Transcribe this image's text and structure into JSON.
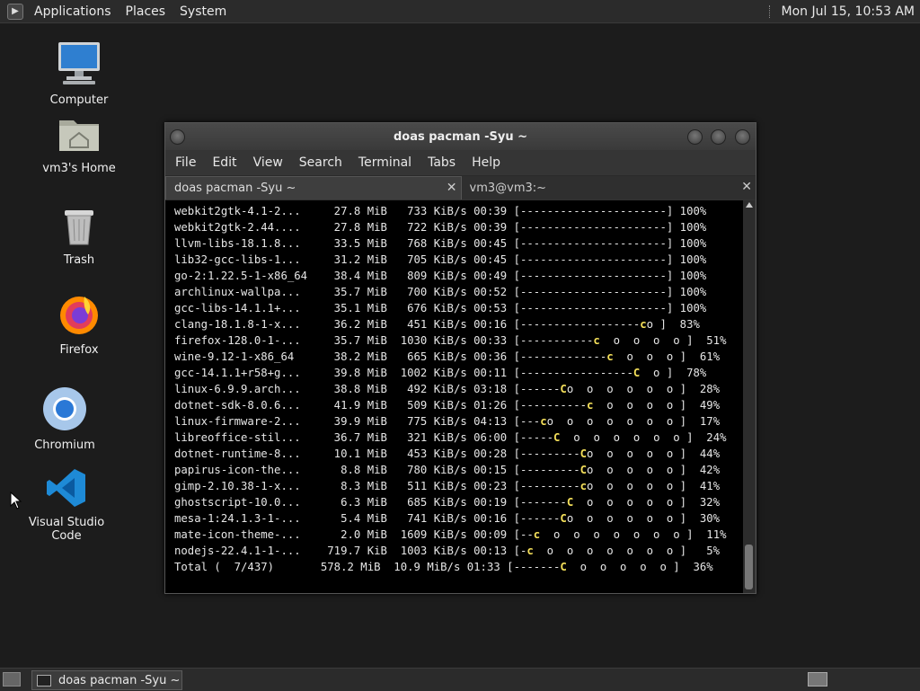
{
  "top_panel": {
    "menus": [
      "Applications",
      "Places",
      "System"
    ],
    "clock": "Mon Jul 15, 10:53 AM"
  },
  "desktop_icons": [
    {
      "label": "Computer",
      "icon": "computer-icon"
    },
    {
      "label": "vm3's Home",
      "icon": "home-folder-icon"
    },
    {
      "label": "Trash",
      "icon": "trash-icon"
    },
    {
      "label": "Firefox",
      "icon": "firefox-icon"
    },
    {
      "label": "Chromium",
      "icon": "chromium-icon"
    },
    {
      "label": "Visual Studio Code",
      "icon": "vscode-icon"
    }
  ],
  "terminal": {
    "title": "doas pacman -Syu ~",
    "menu": [
      "File",
      "Edit",
      "View",
      "Search",
      "Terminal",
      "Tabs",
      "Help"
    ],
    "tabs": [
      {
        "label": "doas pacman -Syu ~",
        "active": true
      },
      {
        "label": "vm3@vm3:~",
        "active": false
      }
    ],
    "lines": [
      [
        "webkit2gtk-4.1-2...     27.8 MiB   733 KiB/s 00:39 [",
        "----------------------] 100%",
        "",
        ""
      ],
      [
        "webkit2gtk-2.44....     27.8 MiB   722 KiB/s 00:39 [",
        "----------------------] 100%",
        "",
        ""
      ],
      [
        "llvm-libs-18.1.8...     33.5 MiB   768 KiB/s 00:45 [",
        "----------------------] 100%",
        "",
        ""
      ],
      [
        "lib32-gcc-libs-1...     31.2 MiB   705 KiB/s 00:45 [",
        "----------------------] 100%",
        "",
        ""
      ],
      [
        "go-2:1.22.5-1-x86_64    38.4 MiB   809 KiB/s 00:49 [",
        "----------------------] 100%",
        "",
        ""
      ],
      [
        "archlinux-wallpa...     35.7 MiB   700 KiB/s 00:52 [",
        "----------------------] 100%",
        "",
        ""
      ],
      [
        "gcc-libs-14.1.1+...     35.1 MiB   676 KiB/s 00:53 [",
        "----------------------] 100%",
        "",
        ""
      ],
      [
        "clang-18.1.8-1-x...     36.2 MiB   451 KiB/s 00:16 [",
        "------------------",
        "c",
        "o ]  83%"
      ],
      [
        "firefox-128.0-1-...     35.7 MiB  1030 KiB/s 00:33 [",
        "-----------",
        "c",
        "  o  o  o  o ]  51%"
      ],
      [
        "wine-9.12-1-x86_64      38.2 MiB   665 KiB/s 00:36 [",
        "-------------",
        "c",
        "  o  o  o ]  61%"
      ],
      [
        "gcc-14.1.1+r58+g...     39.8 MiB  1002 KiB/s 00:11 [",
        "-----------------",
        "C",
        "  o ]  78%"
      ],
      [
        "linux-6.9.9.arch...     38.8 MiB   492 KiB/s 03:18 [",
        "------",
        "C",
        "o  o  o  o  o  o ]  28%"
      ],
      [
        "dotnet-sdk-8.0.6...     41.9 MiB   509 KiB/s 01:26 [",
        "----------",
        "c",
        "  o  o  o  o ]  49%"
      ],
      [
        "linux-firmware-2...     39.9 MiB   775 KiB/s 04:13 [",
        "---",
        "c",
        "o  o  o  o  o  o  o ]  17%"
      ],
      [
        "libreoffice-stil...     36.7 MiB   321 KiB/s 06:00 [",
        "-----",
        "C",
        "  o  o  o  o  o  o ]  24%"
      ],
      [
        "dotnet-runtime-8...     10.1 MiB   453 KiB/s 00:28 [",
        "---------",
        "C",
        "o  o  o  o  o ]  44%"
      ],
      [
        "papirus-icon-the...      8.8 MiB   780 KiB/s 00:15 [",
        "---------",
        "C",
        "o  o  o  o  o ]  42%"
      ],
      [
        "gimp-2.10.38-1-x...      8.3 MiB   511 KiB/s 00:23 [",
        "---------",
        "c",
        "o  o  o  o  o ]  41%"
      ],
      [
        "ghostscript-10.0...      6.3 MiB   685 KiB/s 00:19 [",
        "-------",
        "C",
        "  o  o  o  o  o ]  32%"
      ],
      [
        "mesa-1:24.1.3-1-...      5.4 MiB   741 KiB/s 00:16 [",
        "------",
        "C",
        "o  o  o  o  o  o ]  30%"
      ],
      [
        "mate-icon-theme-...      2.0 MiB  1609 KiB/s 00:09 [",
        "--",
        "c",
        "  o  o  o  o  o  o  o ]  11%"
      ],
      [
        "nodejs-22.4.1-1-...    719.7 KiB  1003 KiB/s 00:13 [",
        "-",
        "c",
        "  o  o  o  o  o  o  o ]   5%"
      ],
      [
        "Total (  7/437)       578.2 MiB  10.9 MiB/s 01:33 [",
        "-------",
        "C",
        "  o  o  o  o  o ]  36%"
      ]
    ]
  },
  "taskbar": {
    "task_label": "doas pacman -Syu ~"
  },
  "colors": {
    "desktop_bg": "#1c1c1c",
    "panel_bg": "#2b2b2b",
    "terminal_bg": "#000000",
    "pacman_yellow": "#f5e05a"
  }
}
